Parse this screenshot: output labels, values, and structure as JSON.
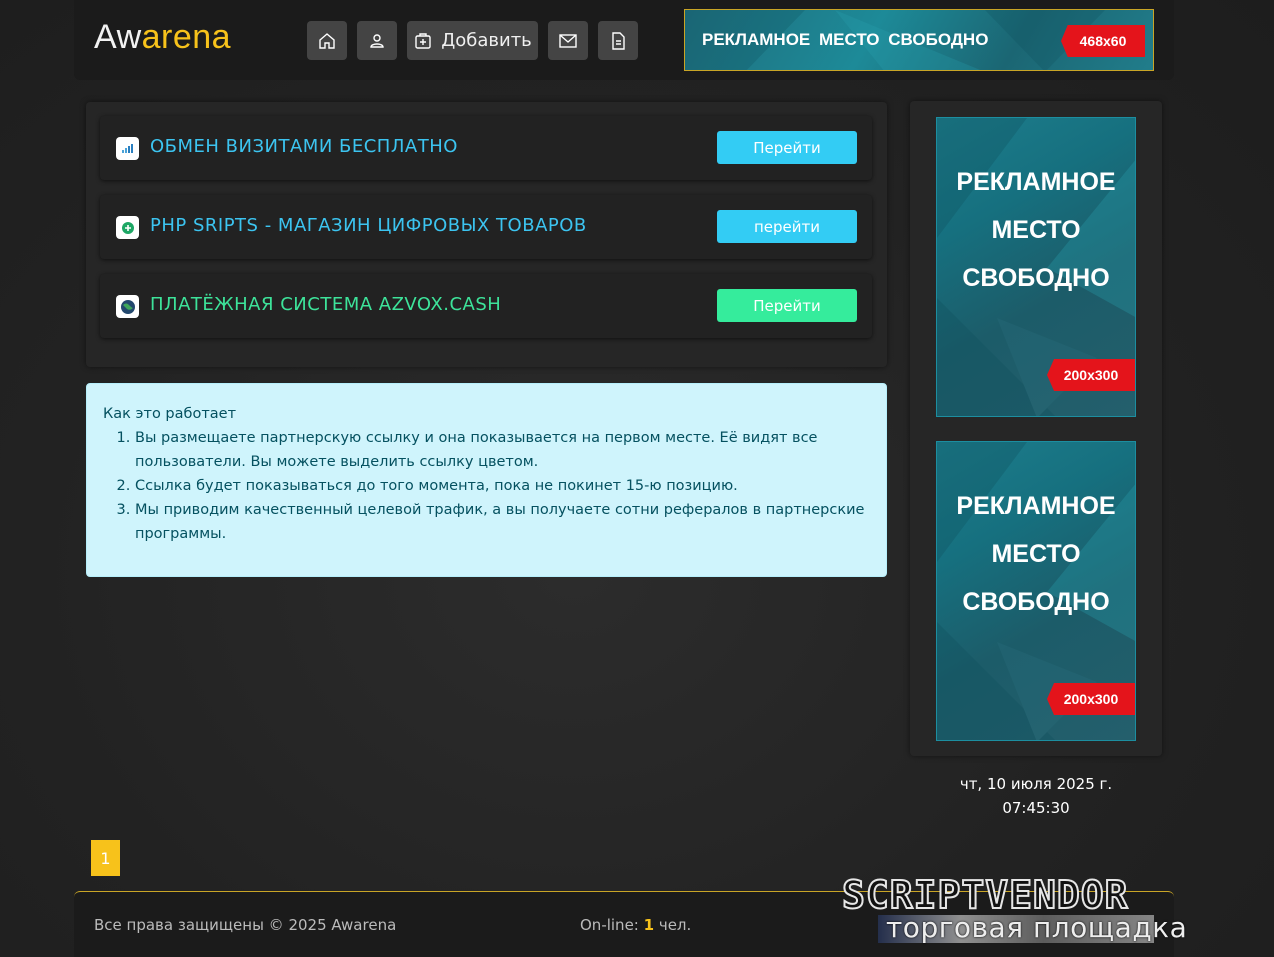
{
  "header": {
    "logo_part1": "Aw",
    "logo_part2": "arena",
    "buttons": [
      {
        "icon": "home-icon",
        "label": ""
      },
      {
        "icon": "user-icon",
        "label": ""
      },
      {
        "icon": "add-icon",
        "label": "Добавить"
      },
      {
        "icon": "mail-icon",
        "label": ""
      },
      {
        "icon": "document-icon",
        "label": ""
      }
    ],
    "banner": {
      "text": "РЕКЛАМНОЕ  МЕСТО СВОБОДНО",
      "size": "468x60"
    }
  },
  "links": [
    {
      "icon": "signal-bars-icon",
      "title": "ОБМЕН ВИЗИТАМИ БЕСПЛАТНО",
      "button": "Перейти",
      "color": "#3cc4f0",
      "button_color": "#33ccf4"
    },
    {
      "icon": "plus-circle-icon",
      "title": "PHP SRIPTS - МАГАЗИН ЦИФРОВЫХ ТОВАРОВ",
      "button": "перейти",
      "color": "#3cc4f0",
      "button_color": "#33ccf4"
    },
    {
      "icon": "globe-icon",
      "title": "ПЛАТЁЖНАЯ СИСТЕМА AZVOX.CASH",
      "button": "Перейти",
      "color": "#3de39a",
      "button_color": "#35ec9c"
    }
  ],
  "info": {
    "heading": "Как это работает",
    "items": [
      "Вы размещаете партнерскую ссылку и она показывается на первом месте. Её видят все пользователи. Вы можете выделить ссылку цветом.",
      "Ссылка будет показываться до того момента, пока не покинет 15-ю позицию.",
      "Мы приводим качественный целевой трафик, а вы получаете сотни рефералов в партнерские программы."
    ]
  },
  "sidebar": {
    "banners": [
      {
        "line1": "РЕКЛАМНОЕ",
        "line2": "МЕСТО",
        "line3": "СВОБОДНО",
        "size": "200x300"
      },
      {
        "line1": "РЕКЛАМНОЕ",
        "line2": "МЕСТО",
        "line3": "СВОБОДНО",
        "size": "200x300"
      }
    ],
    "date": "чт, 10 июля 2025 г.",
    "time": "07:45:30"
  },
  "pagination": {
    "current": "1"
  },
  "footer": {
    "copyright": "Все права защищены © 2025 Awarena",
    "online_label": "On-line: ",
    "online_count": "1",
    "online_suffix": " чел."
  },
  "watermark": {
    "brand": "SCRIPTVENDOR",
    "subtitle": "торговая площадка"
  },
  "colors": {
    "accent": "#f7c21b",
    "background": "#232323",
    "info_bg": "#cff4fc"
  }
}
